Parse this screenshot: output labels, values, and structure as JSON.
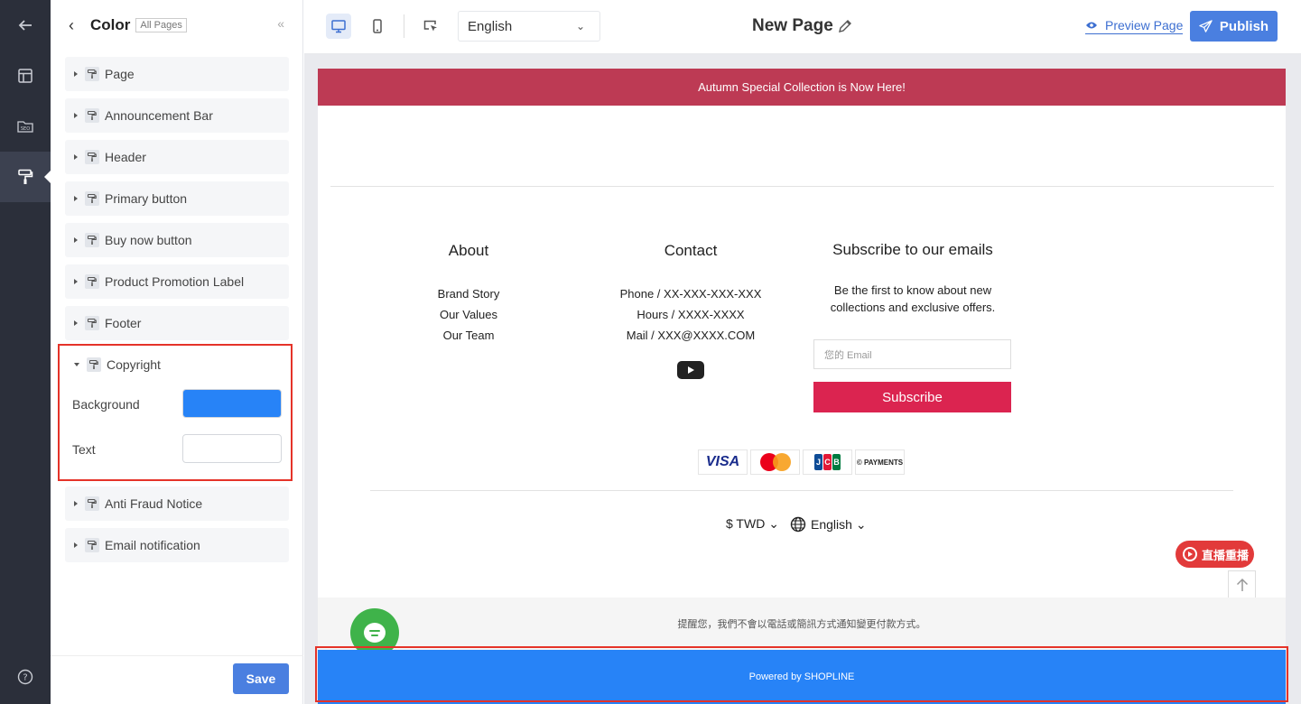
{
  "rail": {
    "items": [
      {
        "icon": "arrow-left-icon"
      },
      {
        "icon": "layout-icon"
      },
      {
        "icon": "seo-folder-icon"
      },
      {
        "icon": "paint-roller-icon",
        "active": true
      },
      {
        "icon": "help-circle-icon"
      }
    ]
  },
  "panel": {
    "title": "Color",
    "scope": "All Pages",
    "groups_top": [
      "Page",
      "Announcement Bar",
      "Header",
      "Primary button",
      "Buy now button",
      "Product Promotion Label",
      "Footer"
    ],
    "copyright": {
      "label": "Copyright",
      "background_label": "Background",
      "background_color": "#2783f7",
      "text_label": "Text",
      "text_color": "#ffffff"
    },
    "groups_bottom": [
      "Anti Fraud Notice",
      "Email notification"
    ],
    "save_label": "Save"
  },
  "topbar": {
    "language": "English",
    "page_name": "New Page",
    "preview_label": "Preview Page",
    "publish_label": "Publish"
  },
  "site": {
    "announcement": "Autumn Special Collection is Now Here!",
    "about": {
      "title": "About",
      "links": [
        "Brand Story",
        "Our Values",
        "Our Team"
      ]
    },
    "contact": {
      "title": "Contact",
      "lines": [
        "Phone / XX-XXX-XXX-XXX",
        "Hours / XXXX-XXXX",
        "Mail / XXX@XXXX.COM"
      ]
    },
    "subscribe": {
      "title": "Subscribe to our emails",
      "description": "Be the first to know about new collections and exclusive offers.",
      "placeholder": "您的 Email",
      "button": "Subscribe"
    },
    "payments": {
      "visa": "VISA",
      "jcb": [
        "J",
        "C",
        "B"
      ],
      "cpay": "PAYMENTS"
    },
    "currency": "$ TWD",
    "language": "English",
    "live_badge": "直播重播",
    "notice": "提醒您，我們不會以電話或簡訊方式通知變更付款方式。",
    "powered": "Powered by SHOPLINE"
  },
  "colors": {
    "announcement_bg": "#bd3a54",
    "subscribe_bg": "#db2450",
    "copyright_bg": "#2783f7",
    "accent": "#4a7fe0",
    "highlight": "#e53329"
  }
}
